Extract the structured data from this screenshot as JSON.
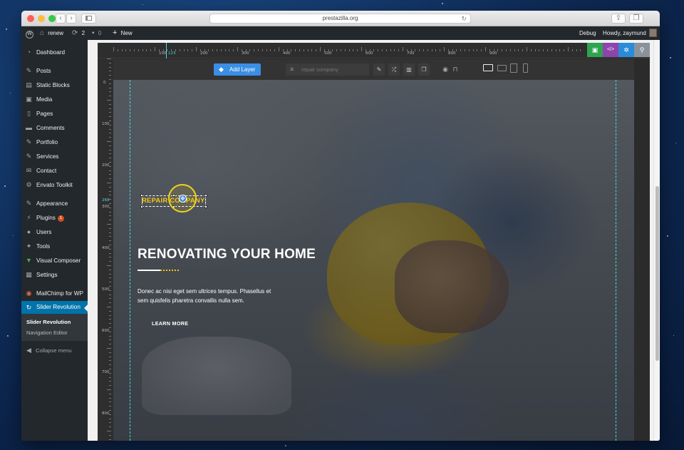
{
  "browser": {
    "url": "prestazilla.org",
    "nav_back": "‹",
    "nav_forward": "›",
    "reload": "↻",
    "new_tab": "+"
  },
  "adminbar": {
    "site_name": "renew",
    "updates_count": "2",
    "comments_count": "0",
    "new_label": "New",
    "debug_label": "Debug",
    "greeting": "Howdy, zaymund"
  },
  "sidebar": {
    "items": [
      {
        "label": "Dashboard",
        "icon": "dashboard-icon"
      },
      {
        "label": "Posts",
        "icon": "pin-icon"
      },
      {
        "label": "Static Blocks",
        "icon": "blocks-icon"
      },
      {
        "label": "Media",
        "icon": "media-icon"
      },
      {
        "label": "Pages",
        "icon": "pages-icon"
      },
      {
        "label": "Comments",
        "icon": "comments-icon"
      },
      {
        "label": "Portfolio",
        "icon": "portfolio-icon"
      },
      {
        "label": "Services",
        "icon": "services-icon"
      },
      {
        "label": "Contact",
        "icon": "contact-icon"
      },
      {
        "label": "Envato Toolkit",
        "icon": "envato-icon"
      },
      {
        "label": "Appearance",
        "icon": "appearance-icon"
      },
      {
        "label": "Plugins",
        "icon": "plugins-icon",
        "badge": "1"
      },
      {
        "label": "Users",
        "icon": "users-icon"
      },
      {
        "label": "Tools",
        "icon": "tools-icon"
      },
      {
        "label": "Visual Composer",
        "icon": "visual-composer-icon"
      },
      {
        "label": "Settings",
        "icon": "settings-icon"
      },
      {
        "label": "MailChimp for WP",
        "icon": "mailchimp-icon"
      },
      {
        "label": "Slider Revolution",
        "icon": "slider-revolution-icon"
      }
    ],
    "submenu": [
      "Slider Revolution",
      "Navigation Editor"
    ],
    "collapse_label": "Collapse menu"
  },
  "editor": {
    "ruler_h": [
      "100",
      "200",
      "300",
      "400",
      "500",
      "600",
      "700",
      "800",
      "900"
    ],
    "ruler_h_marker": "123",
    "ruler_v": [
      "0",
      "100",
      "200",
      "300",
      "400",
      "500",
      "600",
      "700",
      "800"
    ],
    "ruler_v_marker": "268",
    "toolbar": {
      "add_layer_label": "Add Layer",
      "layer_select_value": "repair company"
    },
    "colors": {
      "save": "#2ea44f",
      "code": "#8e44ad",
      "settings": "#2a8bd8",
      "search": "#8a939b",
      "accent": "#f5c518",
      "add_layer": "#3a8ee6"
    }
  },
  "slide": {
    "layer_text": "REPAIR COMPANY",
    "heading": "RENOVATING YOUR HOME",
    "body": "Donec ac nisi eget sem ultrices tempus. Phasellus et sem quisfelis pharetra convallis nulla sem.",
    "button": "LEARN MORE"
  }
}
